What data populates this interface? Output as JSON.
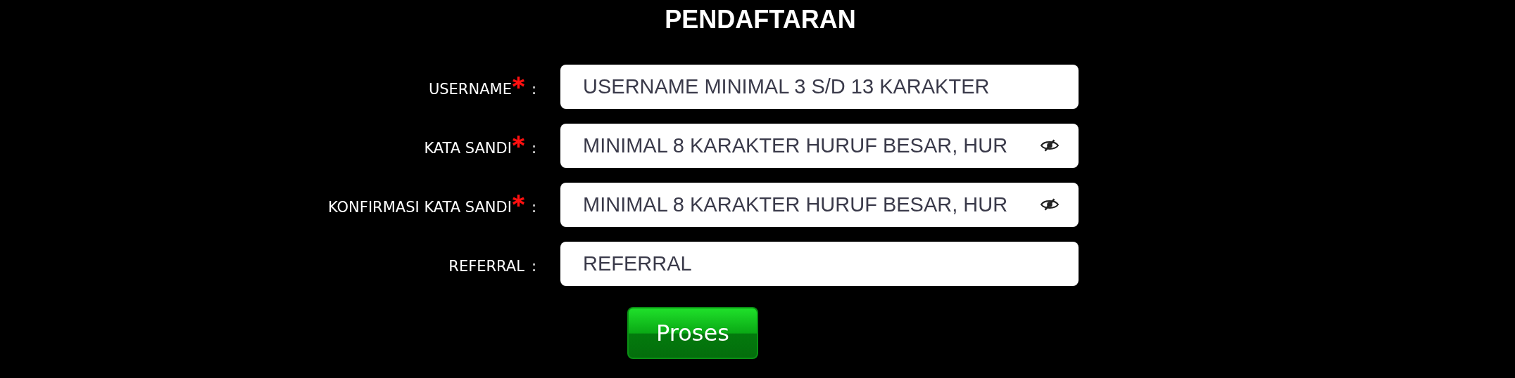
{
  "title": "PENDAFTARAN",
  "fields": [
    {
      "kind": "text",
      "label": "USERNAME",
      "required": true,
      "placeholder": "USERNAME MINIMAL 3 S/D 13 KARAKTER"
    },
    {
      "kind": "password",
      "label": "KATA SANDI",
      "required": true,
      "placeholder": "MINIMAL 8 KARAKTER HURUF BESAR, HUR"
    },
    {
      "kind": "password",
      "label": "KONFIRMASI KATA SANDI",
      "required": true,
      "placeholder": "MINIMAL 8 KARAKTER HURUF BESAR, HUR"
    },
    {
      "kind": "text",
      "label": "REFERRAL",
      "required": false,
      "placeholder": "REFERRAL"
    }
  ],
  "colon": ":",
  "submit": "Proses"
}
